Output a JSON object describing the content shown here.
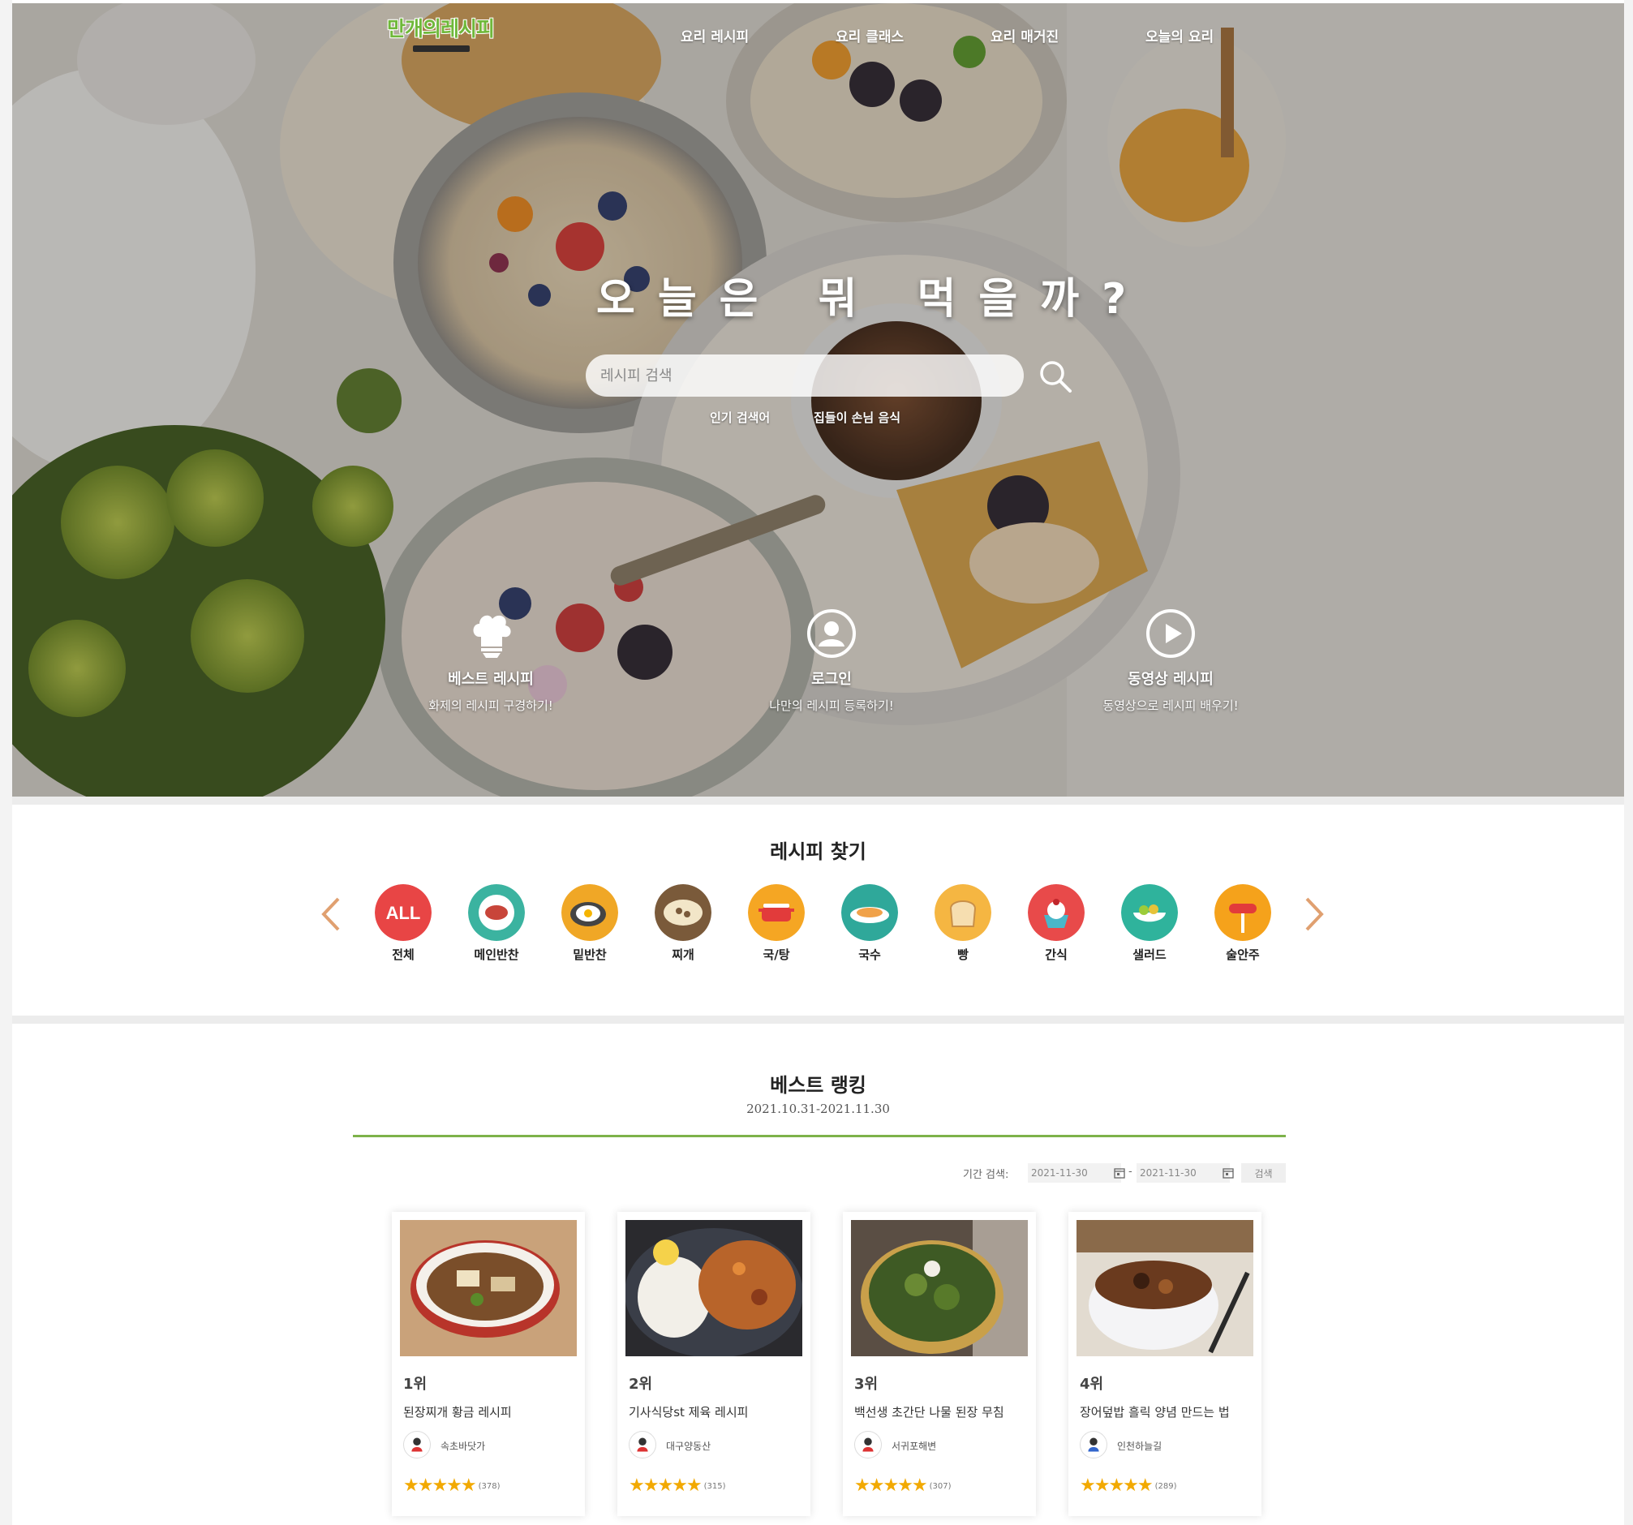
{
  "logo": {
    "text": "만개의레시피"
  },
  "nav": [
    "요리 레시피",
    "요리 클래스",
    "요리 매거진",
    "오늘의 요리"
  ],
  "hero": {
    "title": "오늘은 뭐 먹을까?",
    "search_placeholder": "레시피 검색",
    "popular_label": "인기 검색어",
    "popular_keyword": "집들이 손님 음식"
  },
  "quick_links": [
    {
      "icon": "chef-hat-icon",
      "title": "베스트 레시피",
      "desc": "화제의 레시피 구경하기!"
    },
    {
      "icon": "user-circle-icon",
      "title": "로그인",
      "desc": "나만의 레시피 등록하기!"
    },
    {
      "icon": "play-circle-icon",
      "title": "동영상 레시피",
      "desc": "동영상으로 레시피 배우기!"
    }
  ],
  "categories": {
    "title": "레시피 찾기",
    "items": [
      {
        "label": "전체",
        "badge": "ALL",
        "color": "#e84545",
        "icon": "all-icon"
      },
      {
        "label": "메인반찬",
        "color": "#3bb3a0",
        "icon": "meat-plate-icon"
      },
      {
        "label": "밑반찬",
        "color": "#f0a726",
        "icon": "fried-egg-icon"
      },
      {
        "label": "찌개",
        "color": "#7a5a3a",
        "icon": "stew-pot-icon"
      },
      {
        "label": "국/탕",
        "color": "#f5a623",
        "icon": "soup-pot-icon"
      },
      {
        "label": "국수",
        "color": "#2fa89a",
        "icon": "noodle-icon"
      },
      {
        "label": "빵",
        "color": "#f5b642",
        "icon": "bread-icon"
      },
      {
        "label": "간식",
        "color": "#e84a4a",
        "icon": "dessert-icon"
      },
      {
        "label": "샐러드",
        "color": "#2fb39c",
        "icon": "salad-icon"
      },
      {
        "label": "술안주",
        "color": "#f5a21b",
        "icon": "sausage-skewer-icon"
      }
    ]
  },
  "ranking": {
    "title": "베스트 랭킹",
    "period": "2021.10.31-2021.11.30",
    "search_label": "기간 검색:",
    "date_from": "2021-11-30",
    "date_to": "2021-11-30",
    "search_button": "검색",
    "accent_color": "#7db24a",
    "cards": [
      {
        "rank": "1위",
        "title": "된장찌개 황금 레시피",
        "author": "속초바닷가",
        "rating": 5,
        "count": "(378)"
      },
      {
        "rank": "2위",
        "title": "기사식당st 제육 레시피",
        "author": "대구양동산",
        "rating": 5,
        "count": "(315)"
      },
      {
        "rank": "3위",
        "title": "백선생 초간단 나물 된장 무침",
        "author": "서귀포해변",
        "rating": 5,
        "count": "(307)"
      },
      {
        "rank": "4위",
        "title": "장어덮밥 흘릭 양념 만드는 법",
        "author": "인천하늘길",
        "rating": 5,
        "count": "(289)"
      }
    ]
  }
}
